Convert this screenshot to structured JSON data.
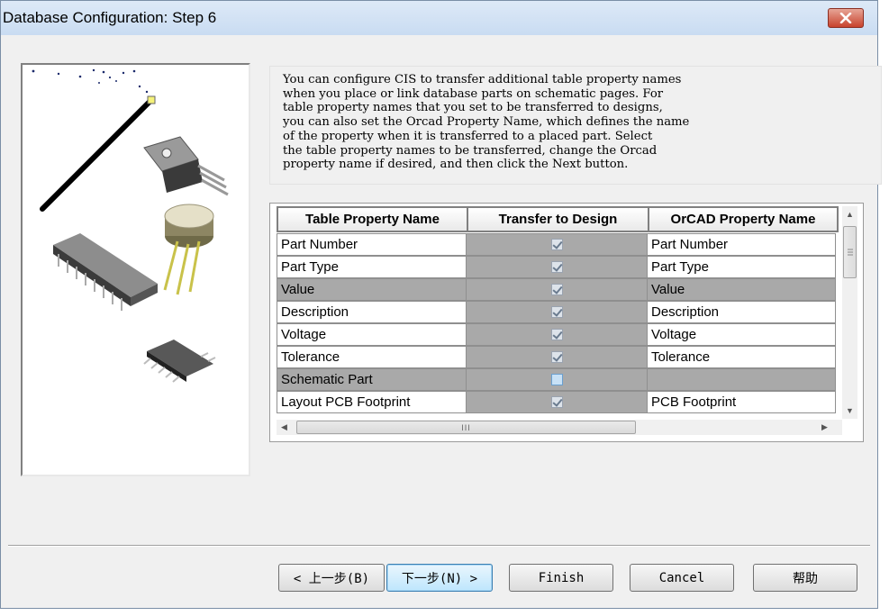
{
  "window": {
    "title": "Database Configuration: Step 6"
  },
  "description": "You can configure CIS to transfer additional table property names\nwhen you place or link database parts on schematic pages. For\ntable property names that you set to be transferred to designs,\nyou can also set the Orcad Property Name, which defines the name\nof the property when it is transferred to a placed part. Select\nthe table property names to be transferred, change the Orcad\nproperty name if desired, and then click the Next button.",
  "grid": {
    "headers": [
      "Table Property Name",
      "Transfer to Design",
      "OrCAD Property Name"
    ],
    "rows": [
      {
        "name": "Part Number",
        "transfer": true,
        "orcad": "Part Number",
        "selected": false
      },
      {
        "name": "Part Type",
        "transfer": true,
        "orcad": "Part Type",
        "selected": false
      },
      {
        "name": "Value",
        "transfer": true,
        "orcad": "Value",
        "selected": true
      },
      {
        "name": "Description",
        "transfer": true,
        "orcad": "Description",
        "selected": false
      },
      {
        "name": "Voltage",
        "transfer": true,
        "orcad": "Voltage",
        "selected": false
      },
      {
        "name": "Tolerance",
        "transfer": true,
        "orcad": "Tolerance",
        "selected": false
      },
      {
        "name": "Schematic Part",
        "transfer": false,
        "orcad": "",
        "selected": true
      },
      {
        "name": "Layout PCB Footprint",
        "transfer": true,
        "orcad": "PCB Footprint",
        "selected": false
      }
    ],
    "hscroll_thumb_grip": "III"
  },
  "buttons": {
    "back": "< 上一步(B)",
    "next": "下一步(N) >",
    "finish": "Finish",
    "cancel": "Cancel",
    "help": "帮助"
  },
  "colors": {
    "selected_row": "#a9a9a9",
    "title_bar": "#c9dcf2",
    "close_button": "#c8432d",
    "default_button": "#bee6fd"
  }
}
